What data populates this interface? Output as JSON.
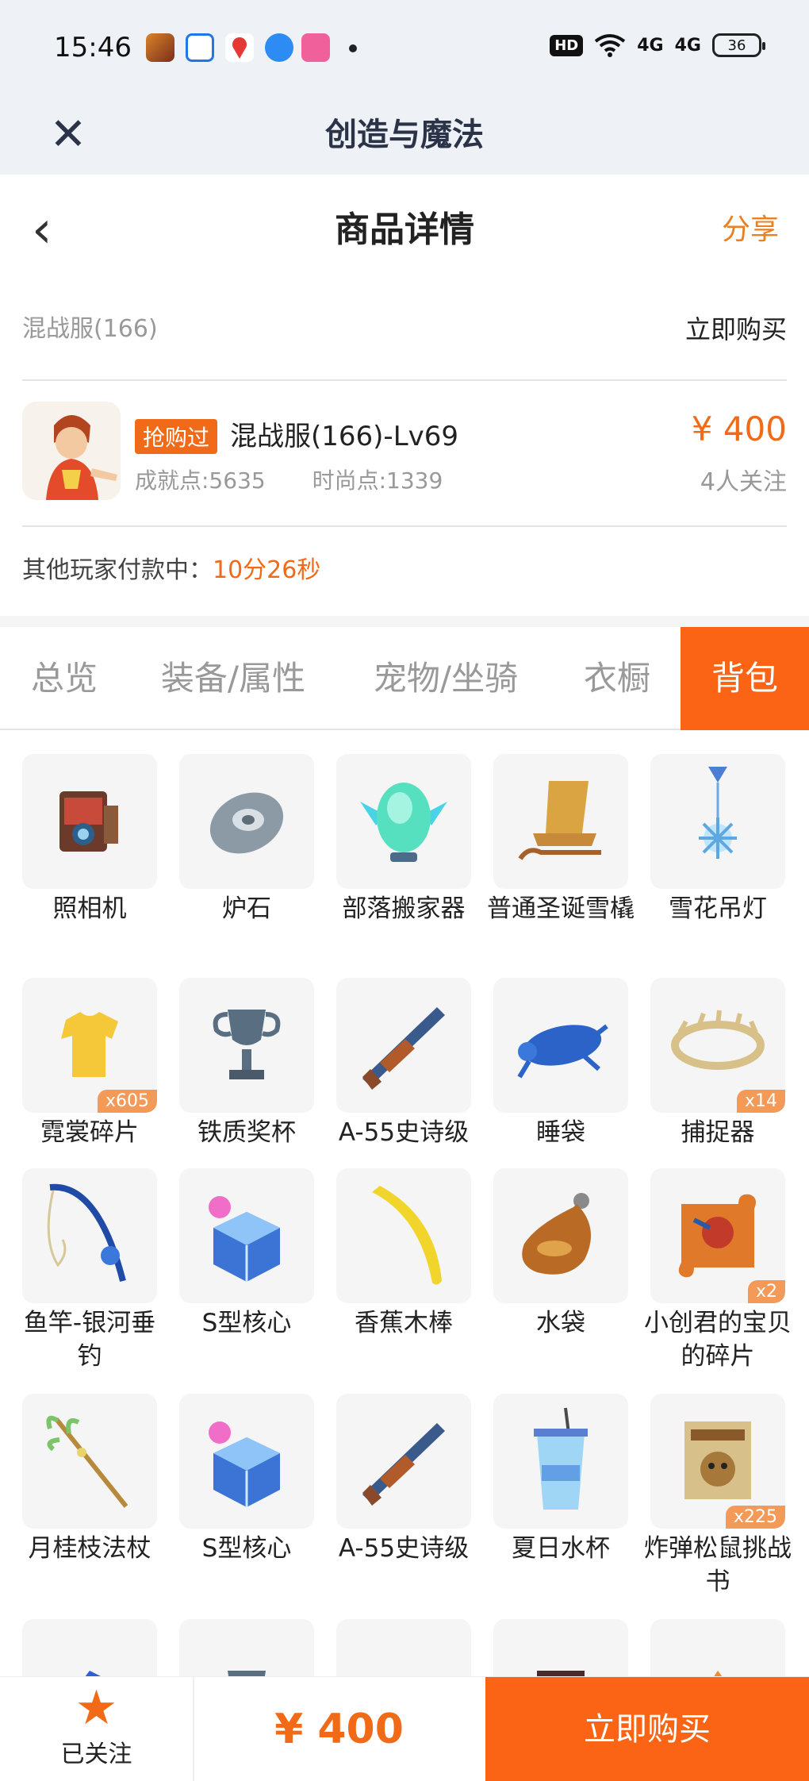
{
  "status_bar": {
    "time": "15:46",
    "network": "4G",
    "hd": "HD",
    "battery": "36"
  },
  "app_bar": {
    "title": "创造与魔法"
  },
  "nav": {
    "title": "商品详情",
    "share": "分享"
  },
  "server_row": {
    "server": "混战服(166)",
    "buy": "立即购买"
  },
  "product": {
    "tag": "抢购过",
    "title": "混战服(166)-Lv69",
    "achievement": "成就点:5635",
    "fashion": "时尚点:1339",
    "price": "¥ 400",
    "followers": "4人关注"
  },
  "paying": {
    "label": "其他玩家付款中：",
    "countdown": "10分26秒"
  },
  "tabs": [
    {
      "label": "总览"
    },
    {
      "label": "装备/属性"
    },
    {
      "label": "宠物/坐骑"
    },
    {
      "label": "衣橱"
    },
    {
      "label": "背包"
    }
  ],
  "active_tab": "背包",
  "items": [
    {
      "label": "照相机",
      "icon": "camera-icon",
      "badge": ""
    },
    {
      "label": "炉石",
      "icon": "hearthstone-icon",
      "badge": ""
    },
    {
      "label": "部落搬家器",
      "icon": "tribe-mover-icon",
      "badge": ""
    },
    {
      "label": "普通圣诞雪橇",
      "icon": "sled-icon",
      "badge": ""
    },
    {
      "label": "雪花吊灯",
      "icon": "snowflake-lamp-icon",
      "badge": ""
    },
    {
      "label": "霓裳碎片",
      "icon": "shirt-icon",
      "badge": "x605"
    },
    {
      "label": "铁质奖杯",
      "icon": "trophy-icon",
      "badge": ""
    },
    {
      "label": "A-55史诗级",
      "icon": "gun-icon",
      "badge": ""
    },
    {
      "label": "睡袋",
      "icon": "sleeping-bag-icon",
      "badge": ""
    },
    {
      "label": "捕捉器",
      "icon": "catcher-icon",
      "badge": "x14"
    },
    {
      "label": "鱼竿-银河垂钓",
      "icon": "fishing-rod-icon",
      "badge": ""
    },
    {
      "label": "S型核心",
      "icon": "core-cube-icon",
      "badge": ""
    },
    {
      "label": "香蕉木棒",
      "icon": "banana-icon",
      "badge": ""
    },
    {
      "label": "水袋",
      "icon": "water-bag-icon",
      "badge": ""
    },
    {
      "label": "小创君的宝贝的碎片",
      "icon": "puzzle-icon",
      "badge": "x2"
    },
    {
      "label": "月桂枝法杖",
      "icon": "staff-icon",
      "badge": ""
    },
    {
      "label": "S型核心",
      "icon": "core-cube-icon",
      "badge": ""
    },
    {
      "label": "A-55史诗级",
      "icon": "gun-icon",
      "badge": ""
    },
    {
      "label": "夏日水杯",
      "icon": "cup-icon",
      "badge": ""
    },
    {
      "label": "炸弹松鼠挑战书",
      "icon": "wanted-poster-icon",
      "badge": "x225"
    }
  ],
  "bottom": {
    "follow": "已关注",
    "price": "¥ 400",
    "buy": "立即购买"
  },
  "colors": {
    "accent": "#fa6414",
    "price": "#f06a17",
    "badge": "#f39a58"
  }
}
